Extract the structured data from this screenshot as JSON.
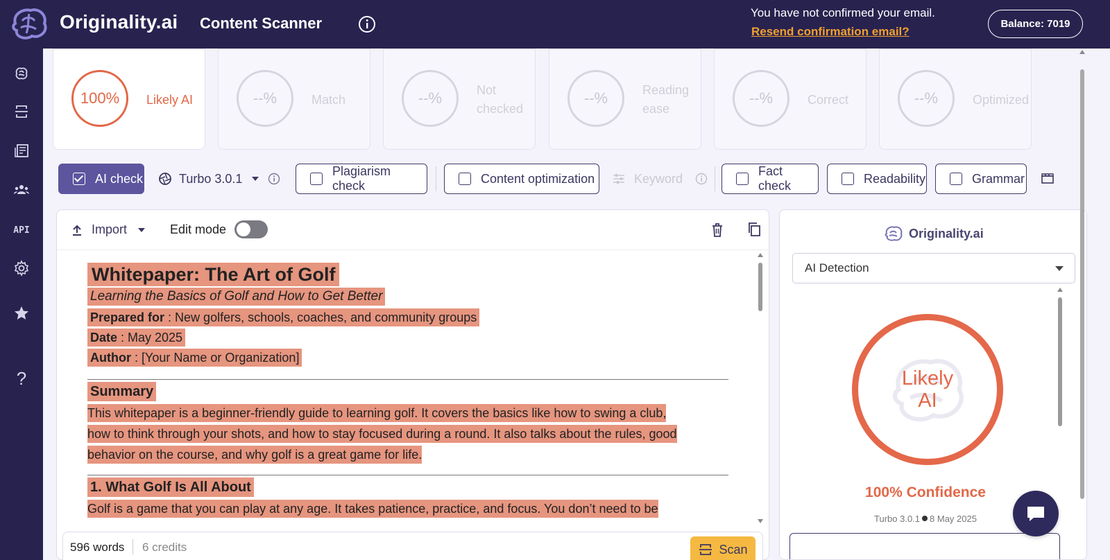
{
  "header": {
    "logo_text": "Originality.ai",
    "page_title": "Content Scanner",
    "email_notice": "You have not confirmed your email.",
    "resend_link": "Resend confirmation email?",
    "balance": "Balance: 7019"
  },
  "sidebar": {
    "items": [
      {
        "icon": "brain-icon"
      },
      {
        "icon": "scan-icon"
      },
      {
        "icon": "news-icon"
      },
      {
        "icon": "team-icon"
      },
      {
        "icon": "api-icon",
        "label": "API"
      },
      {
        "icon": "gear-icon"
      },
      {
        "icon": "star-icon"
      },
      {
        "icon": "help-icon",
        "label": "?"
      }
    ]
  },
  "score_cards": [
    {
      "value": "100%",
      "label": "Likely AI",
      "active": true
    },
    {
      "value": "--%",
      "label": "Match"
    },
    {
      "value": "--%",
      "label": "Not checked"
    },
    {
      "value": "--%",
      "label": "Reading ease"
    },
    {
      "value": "--%",
      "label": "Correct"
    },
    {
      "value": "--%",
      "label": "Optimized"
    }
  ],
  "tools": {
    "ai_check": "AI check",
    "model": "Turbo 3.0.1",
    "plagiarism": "Plagiarism check",
    "content_opt": "Content optimization",
    "keyword": "Keyword",
    "fact": "Fact check",
    "readability": "Readability",
    "grammar": "Grammar"
  },
  "editor": {
    "import_label": "Import",
    "edit_mode": "Edit mode",
    "doc": {
      "title": "Whitepaper: The Art of Golf",
      "subtitle": "Learning the Basics of Golf and How to Get Better",
      "prepared_label": "Prepared for",
      "prepared_value": " : New golfers, schools, coaches, and community groups",
      "date_label": "Date",
      "date_value": " : May 2025",
      "author_label": "Author",
      "author_value": " : [Your Name or Organization]",
      "summary_heading": "Summary",
      "summary_lines": [
        "This whitepaper is a beginner-friendly guide to learning golf.  It covers the basics like how to swing a club,",
        "how to think through your shots, and how to stay focused during a round.  It also talks about the rules, good",
        "behavior on the course, and why golf is a great game for life."
      ],
      "section1_heading": "1.   What Golf Is All About",
      "section1_line": "Golf is a game that you can play at any age.  It takes patience, practice, and focus.  You don’t need to be"
    },
    "word_count": "596 words",
    "credits": "6 credits",
    "scan_label": "Scan"
  },
  "panel": {
    "brand": "Originality.ai",
    "selected": "AI Detection",
    "verdict_line1": "Likely",
    "verdict_line2": "AI",
    "confidence": "100% Confidence",
    "model": "Turbo 3.0.1",
    "date": "8 May 2025"
  },
  "colors": {
    "navy": "#28224f",
    "accent": "#e26848",
    "purple": "#5d559e",
    "highlight": "#e6957f",
    "scan": "#f5b942"
  }
}
